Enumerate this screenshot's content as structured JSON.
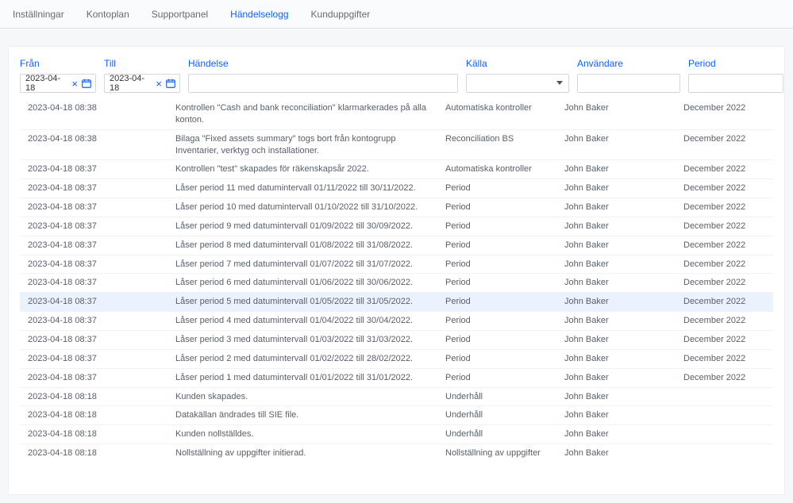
{
  "tabs": [
    {
      "label": "Inställningar",
      "active": false
    },
    {
      "label": "Kontoplan",
      "active": false
    },
    {
      "label": "Supportpanel",
      "active": false
    },
    {
      "label": "Händelselogg",
      "active": true
    },
    {
      "label": "Kunduppgifter",
      "active": false
    }
  ],
  "filters": {
    "from_label": "Från",
    "to_label": "Till",
    "event_label": "Händelse",
    "source_label": "Källa",
    "user_label": "Användare",
    "period_label": "Period",
    "from_value": "2023-04-18",
    "to_value": "2023-04-18",
    "event_value": "",
    "source_value": "",
    "user_value": "",
    "period_value": ""
  },
  "rows": [
    {
      "ts": "2023-04-18 08:38",
      "event": "Kontrollen \"Cash and bank reconciliation\" klarmarkerades på alla konton.",
      "source": "Automatiska kontroller",
      "user": "John Baker",
      "period": "December 2022"
    },
    {
      "ts": "2023-04-18 08:38",
      "event": "Bilaga \"Fixed assets summary\" togs bort från kontogrupp Inventarier, verktyg och installationer.",
      "source": "Reconciliation BS",
      "user": "John Baker",
      "period": "December 2022"
    },
    {
      "ts": "2023-04-18 08:37",
      "event": "Kontrollen \"test\" skapades för räkenskapsår 2022.",
      "source": "Automatiska kontroller",
      "user": "John Baker",
      "period": "December 2022"
    },
    {
      "ts": "2023-04-18 08:37",
      "event": "Låser period 11 med datumintervall 01/11/2022 till 30/11/2022.",
      "source": "Period",
      "user": "John Baker",
      "period": "December 2022"
    },
    {
      "ts": "2023-04-18 08:37",
      "event": "Låser period 10 med datumintervall 01/10/2022 till 31/10/2022.",
      "source": "Period",
      "user": "John Baker",
      "period": "December 2022"
    },
    {
      "ts": "2023-04-18 08:37",
      "event": "Låser period 9 med datumintervall 01/09/2022 till 30/09/2022.",
      "source": "Period",
      "user": "John Baker",
      "period": "December 2022"
    },
    {
      "ts": "2023-04-18 08:37",
      "event": "Låser period 8 med datumintervall 01/08/2022 till 31/08/2022.",
      "source": "Period",
      "user": "John Baker",
      "period": "December 2022"
    },
    {
      "ts": "2023-04-18 08:37",
      "event": "Låser period 7 med datumintervall 01/07/2022 till 31/07/2022.",
      "source": "Period",
      "user": "John Baker",
      "period": "December 2022"
    },
    {
      "ts": "2023-04-18 08:37",
      "event": "Låser period 6 med datumintervall 01/06/2022 till 30/06/2022.",
      "source": "Period",
      "user": "John Baker",
      "period": "December 2022"
    },
    {
      "ts": "2023-04-18 08:37",
      "event": "Låser period 5 med datumintervall 01/05/2022 till 31/05/2022.",
      "source": "Period",
      "user": "John Baker",
      "period": "December 2022",
      "hover": true
    },
    {
      "ts": "2023-04-18 08:37",
      "event": "Låser period 4 med datumintervall 01/04/2022 till 30/04/2022.",
      "source": "Period",
      "user": "John Baker",
      "period": "December 2022"
    },
    {
      "ts": "2023-04-18 08:37",
      "event": "Låser period 3 med datumintervall 01/03/2022 till 31/03/2022.",
      "source": "Period",
      "user": "John Baker",
      "period": "December 2022"
    },
    {
      "ts": "2023-04-18 08:37",
      "event": "Låser period 2 med datumintervall 01/02/2022 till 28/02/2022.",
      "source": "Period",
      "user": "John Baker",
      "period": "December 2022"
    },
    {
      "ts": "2023-04-18 08:37",
      "event": "Låser period 1 med datumintervall 01/01/2022 till 31/01/2022.",
      "source": "Period",
      "user": "John Baker",
      "period": "December 2022"
    },
    {
      "ts": "2023-04-18 08:18",
      "event": "Kunden skapades.",
      "source": "Underhåll",
      "user": "John Baker",
      "period": ""
    },
    {
      "ts": "2023-04-18 08:18",
      "event": "Datakällan ändrades till SIE file.",
      "source": "Underhåll",
      "user": "John Baker",
      "period": ""
    },
    {
      "ts": "2023-04-18 08:18",
      "event": "Kunden nollställdes.",
      "source": "Underhåll",
      "user": "John Baker",
      "period": ""
    },
    {
      "ts": "2023-04-18 08:18",
      "event": "Nollställning av uppgifter initierad.",
      "source": "Nollställning av uppgifter",
      "user": "John Baker",
      "period": ""
    }
  ]
}
